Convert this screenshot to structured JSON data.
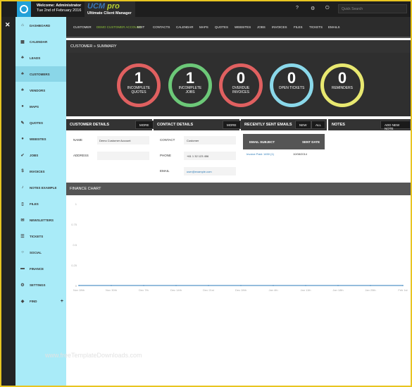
{
  "header": {
    "welcome": "Welcome: Administrator",
    "date": "Tue 2nd of February 2016",
    "brand_ucm": "UCM",
    "brand_pro": "pro",
    "brand_sub": "Ultimate Client Manager",
    "icons": [
      "help-icon",
      "settings-icon",
      "power-icon"
    ],
    "help_glyph": "?",
    "settings_glyph": "⚙",
    "power_glyph": "⏻",
    "search_placeholder": "Quick Search"
  },
  "close_glyph": "✕",
  "sidebar": {
    "items": [
      {
        "label": "Dashboard",
        "icon": "home-icon",
        "glyph": "⌂"
      },
      {
        "label": "Calendar",
        "icon": "calendar-icon",
        "glyph": "▦"
      },
      {
        "label": "Leads",
        "icon": "users-icon",
        "glyph": "♣"
      },
      {
        "label": "Customers",
        "icon": "users-icon",
        "glyph": "♣"
      },
      {
        "label": "Vendors",
        "icon": "users-icon",
        "glyph": "♣"
      },
      {
        "label": "Maps",
        "icon": "globe-icon",
        "glyph": "●"
      },
      {
        "label": "Quotes",
        "icon": "edit-icon",
        "glyph": "✎"
      },
      {
        "label": "Websites",
        "icon": "globe-icon",
        "glyph": "●"
      },
      {
        "label": "Jobs",
        "icon": "check-icon",
        "glyph": "✔"
      },
      {
        "label": "Invoices",
        "icon": "dollar-icon",
        "glyph": "$"
      },
      {
        "label": "Notes Example",
        "icon": "bell-icon",
        "glyph": "♪"
      },
      {
        "label": "Files",
        "icon": "file-icon",
        "glyph": "▯"
      },
      {
        "label": "Newsletters",
        "icon": "mail-icon",
        "glyph": "✉"
      },
      {
        "label": "Tickets",
        "icon": "comments-icon",
        "glyph": "☰"
      },
      {
        "label": "Social",
        "icon": "comment-icon",
        "glyph": "○"
      },
      {
        "label": "Finance",
        "icon": "money-icon",
        "glyph": "▬"
      },
      {
        "label": "Settings",
        "icon": "cogs-icon",
        "glyph": "⚙"
      },
      {
        "label": "Find",
        "icon": "tag-icon",
        "glyph": "◆"
      }
    ],
    "active_index": 3,
    "find_plus": "+"
  },
  "subnav": {
    "items": [
      "Customer",
      "Demo Customer Account",
      "Edit",
      "Contacts",
      "Calendar",
      "Maps",
      "Quotes",
      "Websites",
      "Jobs",
      "Invoices",
      "Files",
      "Tickets",
      "Emails"
    ]
  },
  "summary": {
    "title": "Customer » Summary",
    "circles": [
      {
        "num": "1",
        "label1": "Incomplete",
        "label2": "Quotes",
        "color": "#e06060"
      },
      {
        "num": "1",
        "label1": "Incomplete",
        "label2": "Jobs",
        "color": "#6cc878"
      },
      {
        "num": "0",
        "label1": "Overdue",
        "label2": "Invoices",
        "color": "#e06060"
      },
      {
        "num": "0",
        "label1": "Open Tickets",
        "label2": "",
        "color": "#8ad8ea"
      },
      {
        "num": "0",
        "label1": "Reminders",
        "label2": "",
        "color": "#e8e870"
      }
    ]
  },
  "customer_details": {
    "title": "Customer Details",
    "more_label": "More",
    "name_label": "Name",
    "name_value": "Demo Customer Account",
    "address_label": "Address"
  },
  "contact_details": {
    "title": "Contact Details",
    "more_label": "More",
    "contact_label": "Contact",
    "contact_value": "Customer",
    "phone_label": "Phone",
    "phone_value": "+61 1 32 123 456",
    "email_label": "Email",
    "email_value": "user@example.com"
  },
  "recent_emails": {
    "title": "Recently Sent Emails",
    "new_label": "New",
    "all_label": "All",
    "col_subject": "Email Subject",
    "col_date": "Sent Date",
    "rows": [
      {
        "subject": "Invoice Paid: 1450 (1)",
        "date": "10/08/2014"
      }
    ]
  },
  "notes": {
    "title": "Notes",
    "add_label": "Add New Note"
  },
  "finance": {
    "title": "Finance Chart"
  },
  "chart_data": {
    "type": "line",
    "title": "",
    "xlabel": "",
    "ylabel": "",
    "x": [
      "Nov 28th",
      "Nov 30th",
      "Dec 7th",
      "Dec 14th",
      "Dec 21st",
      "Dec 28th",
      "Jan 4th",
      "Jan 11th",
      "Jan 18th",
      "Jan 25th",
      "Feb 1st"
    ],
    "series": [
      {
        "values": [
          0,
          0,
          0,
          0,
          0,
          0,
          0,
          0,
          0,
          0,
          0
        ],
        "color": "#2a7ab8"
      }
    ],
    "yticks": [
      "1",
      "0.75",
      "0.5",
      "0.25",
      "0"
    ],
    "ylim": [
      0,
      1
    ],
    "grid": false
  },
  "watermark": "www.freeTemplateDownloads.com"
}
